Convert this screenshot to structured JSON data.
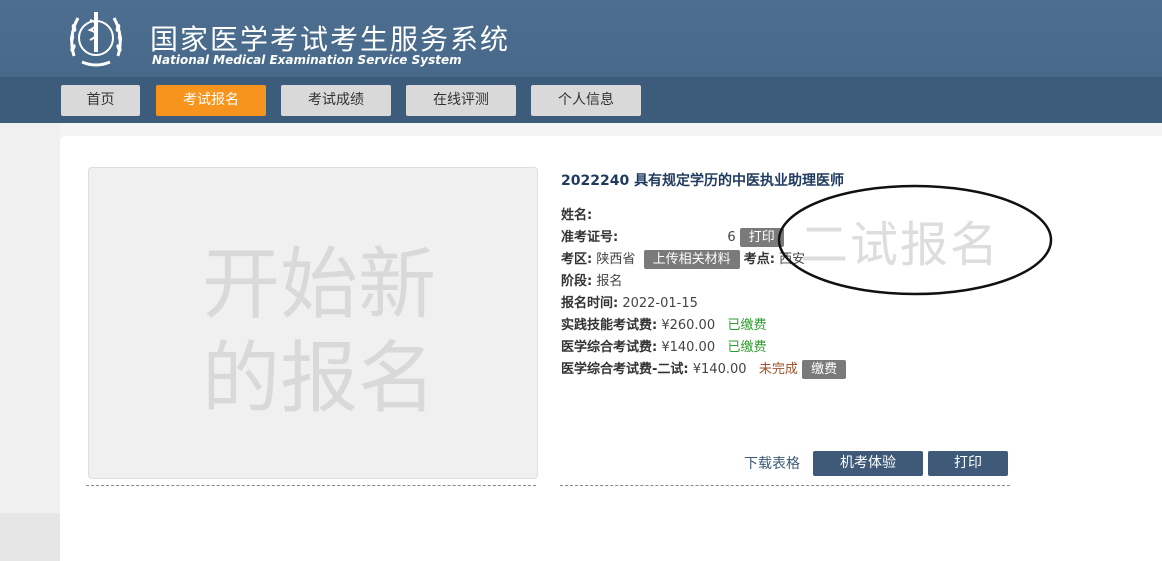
{
  "header": {
    "title_cn": "国家医学考试考生服务系统",
    "title_en": "National Medical Examination Service System"
  },
  "nav": [
    {
      "label": "首页",
      "active": false
    },
    {
      "label": "考试报名",
      "active": true
    },
    {
      "label": "考试成绩",
      "active": false
    },
    {
      "label": "在线评测",
      "active": false
    },
    {
      "label": "个人信息",
      "active": false
    }
  ],
  "new_registration": {
    "line1": "开始新",
    "line2": "的报名"
  },
  "exam": {
    "title": "2022240 具有规定学历的中医执业助理医师",
    "name_label": "姓名:",
    "ticket_label": "准考证号:",
    "ticket_value_partial": "6",
    "print_small": "打印",
    "area_label": "考区:",
    "area_value": "陕西省",
    "upload_button": "上传相关材料",
    "site_label": "考点:",
    "site_value": "西安",
    "stage_label": "阶段:",
    "stage_value": "报名",
    "reg_time_label": "报名时间:",
    "reg_time_value": "2022-01-15",
    "fees": [
      {
        "label": "实践技能考试费:",
        "amount": "¥260.00",
        "status": "已缴费"
      },
      {
        "label": "医学综合考试费:",
        "amount": "¥140.00",
        "status": "已缴费"
      },
      {
        "label": "医学综合考试费-二试:",
        "amount": "¥140.00",
        "status": "未完成",
        "action": "缴费"
      }
    ],
    "watermark": "二试报名"
  },
  "actions": {
    "download": "下载表格",
    "cbt": "机考体验",
    "print": "打印"
  },
  "colors": {
    "header": "#4d6e8f",
    "nav_active": "#f7941d",
    "button_dark": "#3e5a78"
  }
}
